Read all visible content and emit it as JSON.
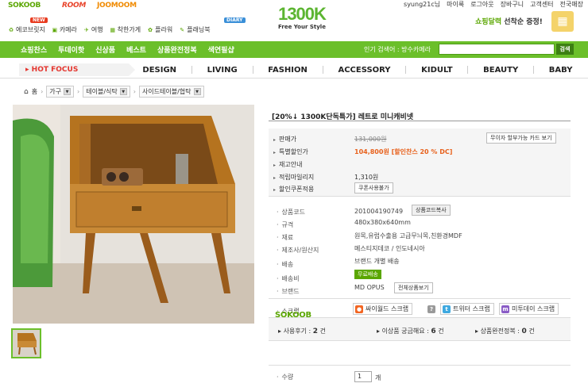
{
  "top_sites": [
    "SOKOOB",
    "ROOM",
    "JOOMOOM"
  ],
  "top_links": [
    "syung21c님",
    "마이룩",
    "로그아웃",
    "장바구니",
    "고객센터",
    "전국매장"
  ],
  "services": [
    {
      "label": "에코브릿지",
      "icon": "eco-icon"
    },
    {
      "label": "카메라",
      "icon": "camera-icon"
    },
    {
      "label": "여행",
      "icon": "plane-icon"
    },
    {
      "label": "착한가게",
      "icon": "gift-icon"
    },
    {
      "label": "플라워",
      "icon": "flower-icon"
    },
    {
      "label": "플래닝북",
      "icon": "book-icon"
    }
  ],
  "badges": {
    "new": "NEW",
    "diary": "DIARY"
  },
  "logo": {
    "main": "1300K",
    "tagline": "Free Your Style"
  },
  "promo": {
    "green": "쇼핑달력",
    "black": "선착순 증정!"
  },
  "gnav": [
    "쇼핑찬스",
    "투데이핫",
    "신상품",
    "베스트",
    "상품완전정복",
    "색연필샵"
  ],
  "search": {
    "label": "인기 검색어 : 방수카메라",
    "button": "검색"
  },
  "hot_focus": "HOT FOCUS",
  "categories": [
    "DESIGN",
    "LIVING",
    "FASHION",
    "ACCESSORY",
    "KIDULT",
    "BEAUTY",
    "BABY"
  ],
  "breadcrumb": {
    "home": "홈",
    "items": [
      "가구",
      "테이블/식탁",
      "사이드테이블/협탁"
    ]
  },
  "product": {
    "title": "[20%↓ 1300K단독특가] 레트로 미니캐비넷",
    "price_label": "판매가",
    "price": "131,000원",
    "installment_button": "무이자 할부가능 카드 보기",
    "special_label": "특별할인가",
    "special_price": "104,800원",
    "special_note": "[할인찬스 20 % DC]",
    "stock_label": "재고안내",
    "mileage_label": "적립마일리지",
    "mileage": "1,310원",
    "coupon_label": "할인쿠폰적용",
    "coupon_button": "쿠폰사용불가"
  },
  "specs": [
    {
      "label": "상품코드",
      "value": "201004190749"
    },
    {
      "label": "규격",
      "value": "480x380x640mm"
    },
    {
      "label": "재료",
      "value": "원목,유럽수출용 고급무늬목,친환경MDF"
    },
    {
      "label": "제조사/원산지",
      "value": "메스티지데코 / 인도네시아"
    },
    {
      "label": "배송",
      "value": "브랜드 개별 배송"
    },
    {
      "label": "배송비",
      "value": ""
    },
    {
      "label": "브랜드",
      "value": "MD OPUS"
    }
  ],
  "spec_buttons": {
    "copy_code": "상품코드복사",
    "free_shipping": "무료배송",
    "all_products": "전체상품보기"
  },
  "scrap": {
    "label": "스크랩",
    "items": [
      {
        "label": "싸이월드 스크랩",
        "icon": "cyworld-icon",
        "color": "#f26522"
      },
      {
        "label": "트위터 스크랩",
        "icon": "twitter-icon",
        "color": "#3fa9e0"
      },
      {
        "label": "미투데이 스크랩",
        "icon": "metoday-icon",
        "color": "#8a5cc6"
      }
    ]
  },
  "sokoob_logo": "SOKOOB",
  "stats": [
    {
      "label": "사용후기 :",
      "value": "2",
      "unit": "건"
    },
    {
      "label": "이상품 궁금해요 :",
      "value": "6",
      "unit": "건"
    },
    {
      "label": "상품완전정복 :",
      "value": "0",
      "unit": "건"
    }
  ],
  "quantity": {
    "label": "수량",
    "value": "1",
    "unit": "개"
  },
  "colors": {
    "brand_green": "#6bbf2a",
    "sale_orange": "#e8611c",
    "hot_red": "#e4352e"
  }
}
